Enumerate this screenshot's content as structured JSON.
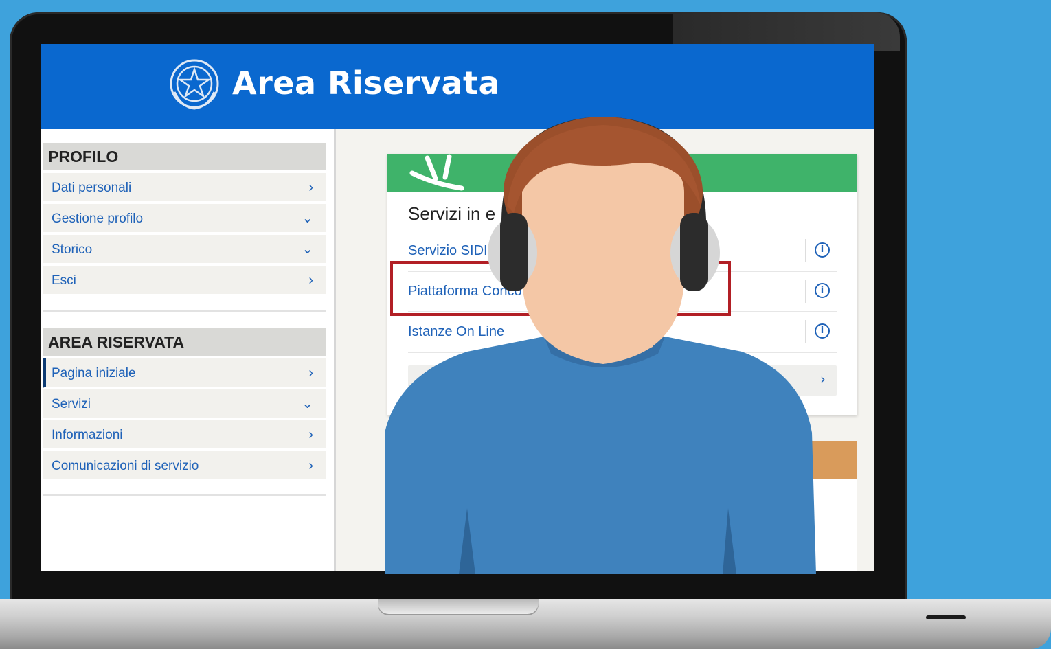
{
  "header": {
    "title": "Area Riservata",
    "logo_icon": "italian-republic-emblem-icon"
  },
  "sidebar": {
    "profile_section": {
      "heading": "PROFILO",
      "items": [
        {
          "label": "Dati personali",
          "icon": "chevron-right-icon",
          "chev": "›"
        },
        {
          "label": "Gestione profilo",
          "icon": "chevron-down-icon",
          "chev": "⌄"
        },
        {
          "label": "Storico",
          "icon": "chevron-down-icon",
          "chev": "⌄"
        },
        {
          "label": "Esci",
          "icon": "chevron-right-icon",
          "chev": "›"
        }
      ]
    },
    "area_section": {
      "heading": "AREA RISERVATA",
      "items": [
        {
          "label": "Pagina iniziale",
          "icon": "chevron-right-icon",
          "chev": "›",
          "active": true
        },
        {
          "label": "Servizi",
          "icon": "chevron-down-icon",
          "chev": "⌄"
        },
        {
          "label": "Informazioni",
          "icon": "chevron-right-icon",
          "chev": "›"
        },
        {
          "label": "Comunicazioni di servizio",
          "icon": "chevron-right-icon",
          "chev": "›"
        }
      ]
    }
  },
  "main": {
    "card_title": "Servizi in e",
    "services": [
      {
        "label": "Servizio SIDI",
        "info": "i"
      },
      {
        "label": "Piattaforma Conco",
        "info": "i"
      },
      {
        "label": "Istanze On Line",
        "info": "i"
      }
    ],
    "more_chev": "›"
  },
  "colors": {
    "header_blue": "#0a68cf",
    "card_green": "#3fb36a",
    "highlight_red": "#b21f25",
    "link_blue": "#1f62b8",
    "background": "#3ea2dc"
  }
}
